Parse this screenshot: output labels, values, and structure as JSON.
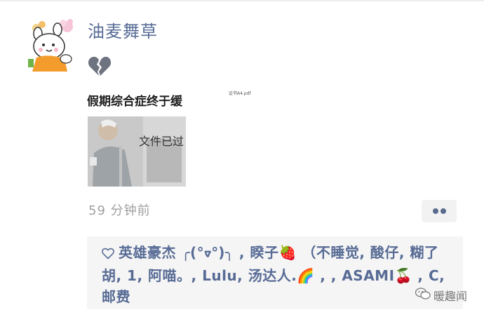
{
  "post": {
    "username": "油麦舞草",
    "status_emoji": "broken-heart-icon",
    "image": {
      "caption_top": "假期综合症终于缓",
      "caption_side": "文件已过",
      "caption_small": "证书A4.pdf"
    },
    "timestamp": "59 分钟前"
  },
  "likes": {
    "text": "英雄豪杰 ╭(°ᢦ°)╮ , 睽子🍓 （不睡觉, 酸仔, 糊了胡, 1, 阿喵。, Lulu, 汤达人.🌈 , , ASAMI🍒 , C, 邮费"
  },
  "watermark": {
    "text": "暖趣闻"
  },
  "colors": {
    "link_blue": "#576b95",
    "time_gray": "#a0a0a0",
    "panel_bg": "#f5f5f5"
  }
}
